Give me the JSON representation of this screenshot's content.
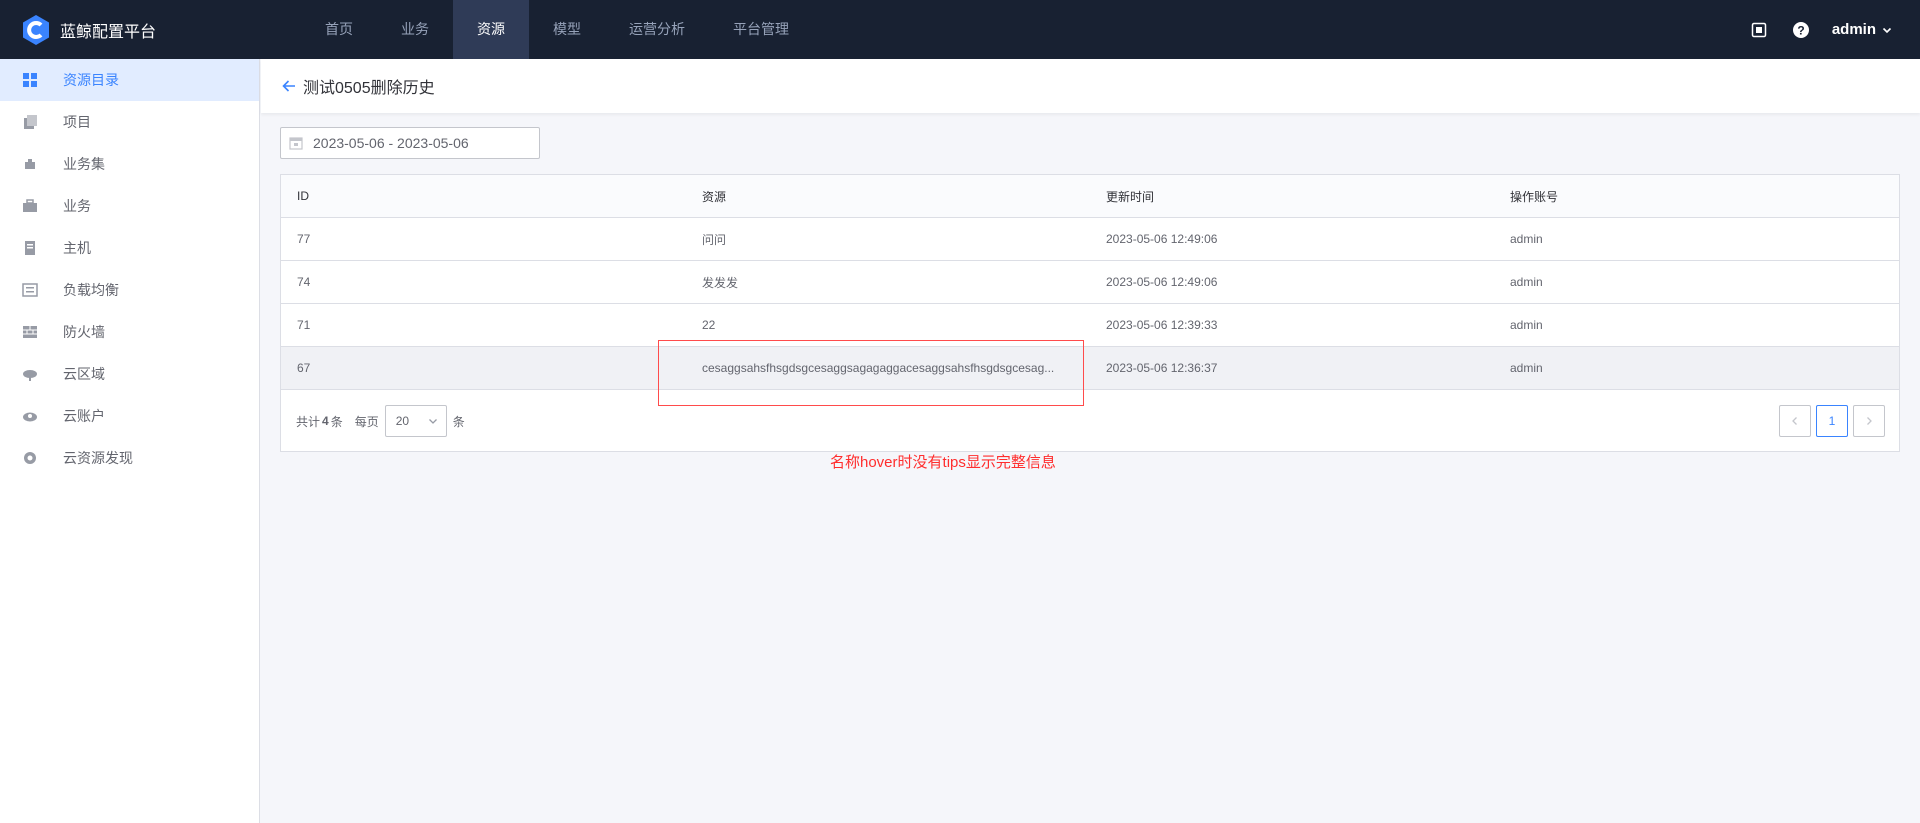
{
  "app": {
    "title": "蓝鲸配置平台"
  },
  "nav": [
    {
      "label": "首页",
      "active": false
    },
    {
      "label": "业务",
      "active": false
    },
    {
      "label": "资源",
      "active": true
    },
    {
      "label": "模型",
      "active": false
    },
    {
      "label": "运营分析",
      "active": false
    },
    {
      "label": "平台管理",
      "active": false
    }
  ],
  "topRight": {
    "user": "admin",
    "icons": [
      "notice-icon",
      "help-icon"
    ]
  },
  "sidebar": [
    {
      "label": "资源目录",
      "icon": "grid-icon",
      "active": true
    },
    {
      "label": "项目",
      "icon": "project-icon",
      "active": false
    },
    {
      "label": "业务集",
      "icon": "business-set-icon",
      "active": false
    },
    {
      "label": "业务",
      "icon": "briefcase-icon",
      "active": false
    },
    {
      "label": "主机",
      "icon": "host-icon",
      "active": false
    },
    {
      "label": "负载均衡",
      "icon": "load-balancer-icon",
      "active": false
    },
    {
      "label": "防火墙",
      "icon": "firewall-icon",
      "active": false
    },
    {
      "label": "云区域",
      "icon": "cloud-area-icon",
      "active": false
    },
    {
      "label": "云账户",
      "icon": "cloud-account-icon",
      "active": false
    },
    {
      "label": "云资源发现",
      "icon": "cloud-discovery-icon",
      "active": false
    }
  ],
  "page": {
    "title": "测试0505删除历史"
  },
  "dateRange": "2023-05-06 - 2023-05-06",
  "table": {
    "columns": [
      "ID",
      "资源",
      "更新时间",
      "操作账号"
    ],
    "rows": [
      [
        "77",
        "问问",
        "2023-05-06 12:49:06",
        "admin"
      ],
      [
        "74",
        "发发发",
        "2023-05-06 12:49:06",
        "admin"
      ],
      [
        "71",
        "22",
        "2023-05-06 12:39:33",
        "admin"
      ],
      [
        "67",
        "cesaggsahsfhsgdsgcesaggsagagaggacesaggsahsfhsgdsgcesag...",
        "2023-05-06 12:36:37",
        "admin"
      ]
    ]
  },
  "pagination": {
    "totalPrefix": "共计",
    "total": "4",
    "totalSuffix": "条",
    "perPageLabel": "每页",
    "pageSize": "20",
    "unit": "条",
    "currentPage": "1"
  },
  "annotation": "名称hover时没有tips显示完整信息",
  "colors": {
    "topbar": "#182132",
    "accent": "#3a84ff",
    "annotation": "#ff2d2d"
  }
}
